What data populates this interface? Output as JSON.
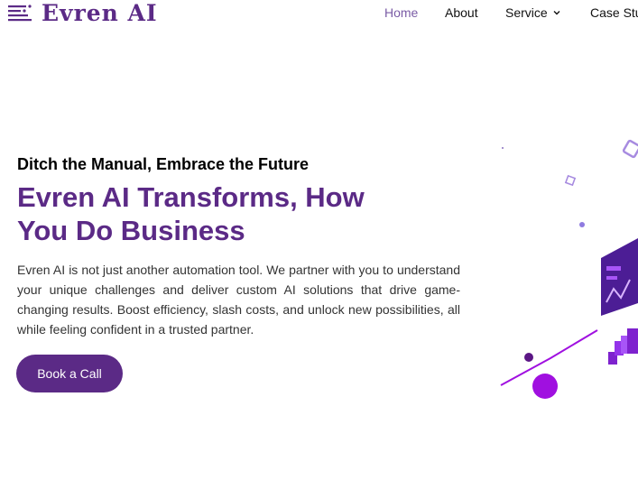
{
  "brand": {
    "name": "Evren AI",
    "logo_icon": "lines-icon",
    "color": "#5b2a86"
  },
  "nav": {
    "home": "Home",
    "about": "About",
    "service": "Service",
    "case_studies": "Case Stu",
    "active": "Home",
    "active_color": "#7a5ba5"
  },
  "hero": {
    "subtitle": "Ditch the Manual, Embrace the Future",
    "title_line1": "Evren AI Transforms, How",
    "title_line2": "You Do Business",
    "paragraph": "Evren AI is not just another automation tool. We partner with you to understand your unique challenges and deliver custom AI solutions that drive game-changing results. Boost efficiency, slash costs, and unlock new possibilities, all while feeling confident in a trusted partner.",
    "cta_label": "Book a Call"
  },
  "colors": {
    "accent": "#5b2a86",
    "illustration_purple": "#a010e0",
    "illustration_violet": "#7a3dd0"
  }
}
